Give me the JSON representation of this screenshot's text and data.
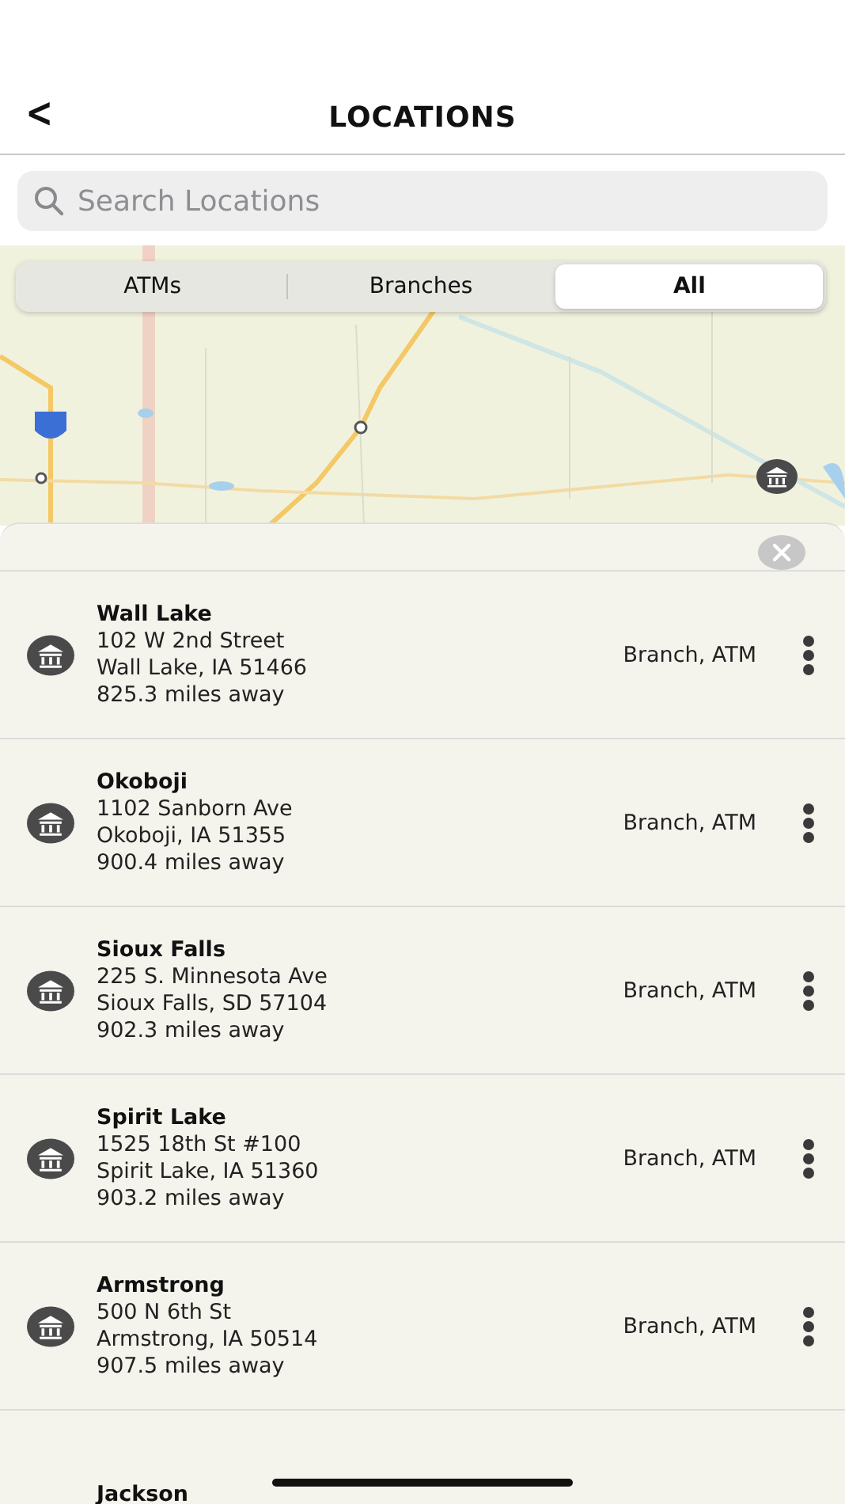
{
  "header": {
    "back": "<",
    "title": "LOCATIONS"
  },
  "search": {
    "placeholder": "Search Locations"
  },
  "segments": [
    {
      "label": "ATMs",
      "selected": false
    },
    {
      "label": "Branches",
      "selected": false
    },
    {
      "label": "All",
      "selected": true
    }
  ],
  "locations": [
    {
      "name": "Wall Lake",
      "address": "102 W 2nd Street",
      "city": "Wall Lake, IA 51466",
      "distance": "825.3 miles away",
      "type": "Branch, ATM"
    },
    {
      "name": "Okoboji",
      "address": "1102 Sanborn Ave",
      "city": "Okoboji, IA 51355",
      "distance": "900.4 miles away",
      "type": "Branch, ATM"
    },
    {
      "name": "Sioux Falls",
      "address": "225 S. Minnesota Ave",
      "city": "Sioux Falls, SD 57104",
      "distance": "902.3 miles away",
      "type": "Branch, ATM"
    },
    {
      "name": "Spirit Lake",
      "address": "1525 18th St #100",
      "city": "Spirit Lake, IA 51360",
      "distance": "903.2 miles away",
      "type": "Branch, ATM"
    },
    {
      "name": "Armstrong",
      "address": "500 N 6th St",
      "city": "Armstrong, IA 50514",
      "distance": "907.5 miles away",
      "type": "Branch, ATM"
    },
    {
      "name": "Jackson"
    }
  ]
}
